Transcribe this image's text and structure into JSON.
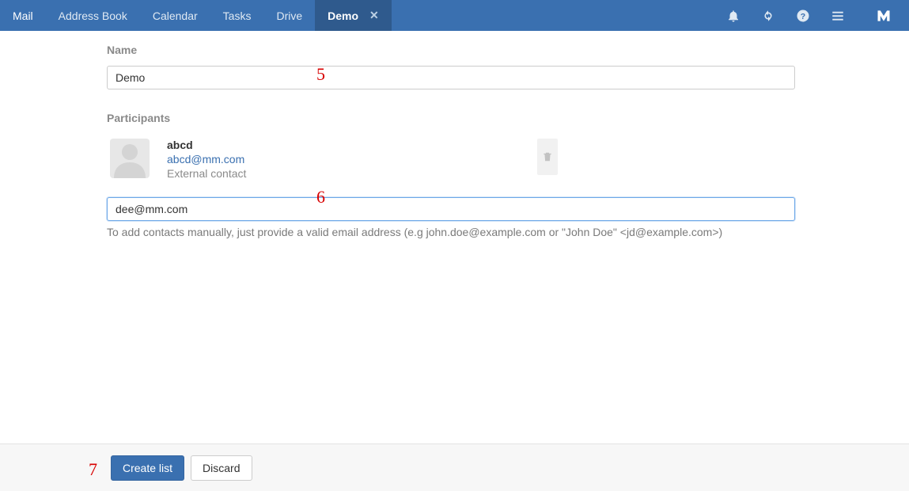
{
  "nav": {
    "tabs": [
      "Mail",
      "Address Book",
      "Calendar",
      "Tasks",
      "Drive"
    ],
    "active_tab": "Demo"
  },
  "form": {
    "name_label": "Name",
    "name_value": "Demo",
    "participants_label": "Participants",
    "participants": [
      {
        "name": "abcd",
        "email": "abcd@mm.com",
        "type": "External contact"
      }
    ],
    "add_value": "dee@mm.com",
    "hint": "To add contacts manually, just provide a valid email address (e.g john.doe@example.com or \"John Doe\" <jd@example.com>)"
  },
  "footer": {
    "create_label": "Create list",
    "discard_label": "Discard"
  },
  "annotations": {
    "a5": "5",
    "a6": "6",
    "a7": "7"
  }
}
